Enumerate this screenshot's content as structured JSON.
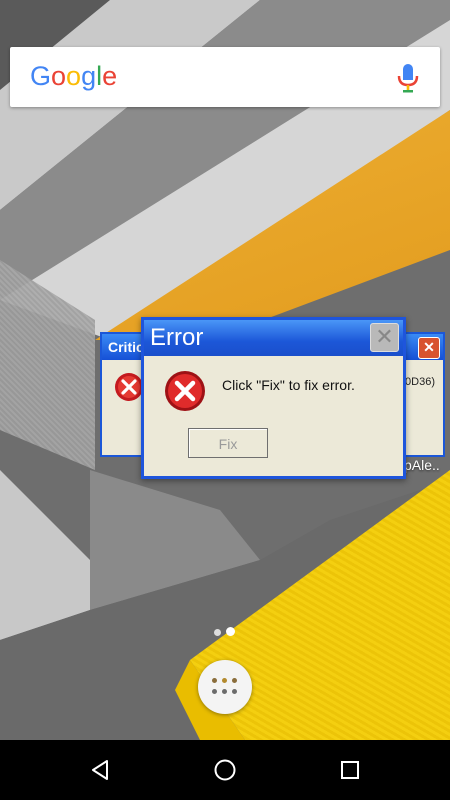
{
  "search": {
    "logo_letters": [
      "G",
      "o",
      "o",
      "g",
      "l",
      "e"
    ],
    "logo_colors": [
      "#4285F4",
      "#EA4335",
      "#FBBC05",
      "#4285F4",
      "#34A853",
      "#EA4335"
    ],
    "mic_icon": "mic-icon"
  },
  "error_window_front": {
    "title": "Error",
    "close_symbol": "✕",
    "message": "Click \"Fix\" to fix error.",
    "fix_label": "Fix"
  },
  "error_window_back": {
    "title": "Critic",
    "close_symbol": "✕",
    "code_text": "0D36)"
  },
  "wallpaper_label": "pAle..",
  "home": {
    "pages": 2,
    "active_page": 2
  },
  "navbar": {
    "back_icon": "back-icon",
    "home_icon": "home-icon",
    "recents_icon": "recents-icon"
  },
  "colors": {
    "xp_title_blue": "#1c57d8",
    "xp_window_bg": "#ece9d8",
    "error_red": "#d8262a",
    "accent_orange": "#e19a1c",
    "accent_yellow": "#f4cf10"
  }
}
